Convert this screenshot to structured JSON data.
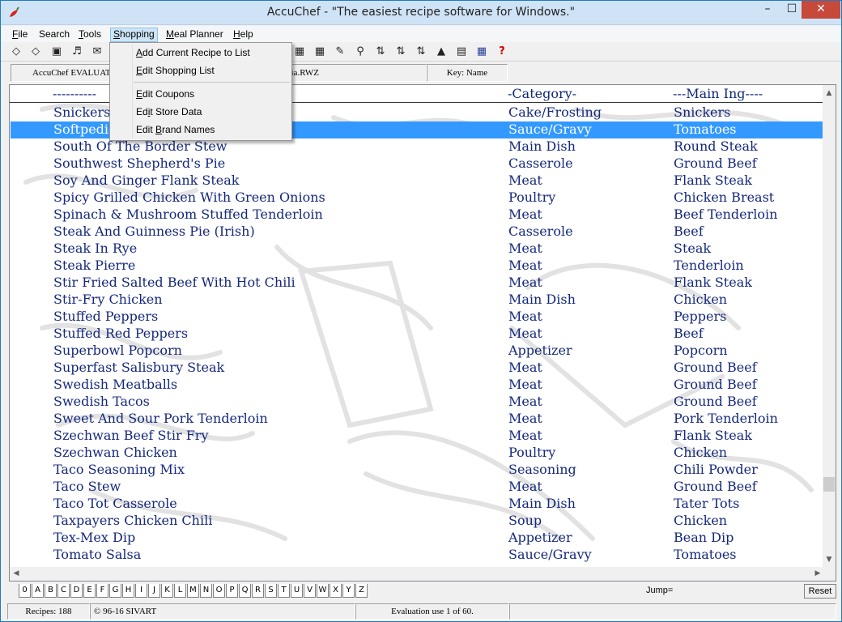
{
  "window": {
    "title": "AccuChef - \"The easiest recipe software for Windows.\""
  },
  "controls": {
    "minimize": "–",
    "maximize": "☐",
    "close": "✕"
  },
  "menu": [
    {
      "label": "File",
      "key": "F",
      "rest": "ile"
    },
    {
      "label": "Search",
      "key": "",
      "rest": "Search"
    },
    {
      "label": "Tools",
      "key": "T",
      "rest": "ools"
    },
    {
      "label": "Shopping",
      "key": "S",
      "rest": "hopping"
    },
    {
      "label": "Meal Planner",
      "key": "M",
      "rest": "eal Planner"
    },
    {
      "label": "Help",
      "key": "H",
      "rest": "elp"
    }
  ],
  "shopping_menu": {
    "items": [
      {
        "pre": "",
        "key": "A",
        "post": "dd Current Recipe to List"
      },
      {
        "pre": "",
        "key": "E",
        "post": "dit Shopping List"
      },
      {
        "pre": "",
        "key": "E",
        "post": "dit Coupons"
      },
      {
        "pre": "Ed",
        "key": "i",
        "post": "t Store Data"
      },
      {
        "pre": "Edit ",
        "key": "B",
        "post": "rand Names"
      }
    ]
  },
  "infobar": {
    "file_left": "AccuChef EVALUAT",
    "file_right": "dia.RWZ",
    "key": "Key: Name"
  },
  "list": {
    "headers": {
      "name": "----------",
      "category": "-Category-",
      "ingredient": "---Main Ing----"
    },
    "rows": [
      {
        "name": "Snickers",
        "category": "Cake/Frosting",
        "ingredient": "Snickers"
      },
      {
        "name": "Softpedia",
        "category": "Sauce/Gravy",
        "ingredient": "Tomatoes"
      },
      {
        "name": "South Of The Border Stew",
        "category": "Main Dish",
        "ingredient": "Round Steak"
      },
      {
        "name": "Southwest Shepherd's Pie",
        "category": "Casserole",
        "ingredient": "Ground Beef"
      },
      {
        "name": "Soy And Ginger Flank Steak",
        "category": "Meat",
        "ingredient": "Flank Steak"
      },
      {
        "name": "Spicy Grilled Chicken With Green Onions",
        "category": "Poultry",
        "ingredient": "Chicken Breast"
      },
      {
        "name": "Spinach & Mushroom Stuffed Tenderloin",
        "category": "Meat",
        "ingredient": "Beef Tenderloin"
      },
      {
        "name": "Steak And Guinness Pie (Irish)",
        "category": "Casserole",
        "ingredient": "Beef"
      },
      {
        "name": "Steak In Rye",
        "category": "Meat",
        "ingredient": "Steak"
      },
      {
        "name": "Steak Pierre",
        "category": "Meat",
        "ingredient": "Tenderloin"
      },
      {
        "name": "Stir Fried Salted Beef With Hot Chili",
        "category": "Meat",
        "ingredient": "Flank Steak"
      },
      {
        "name": "Stir-Fry Chicken",
        "category": "Main Dish",
        "ingredient": "Chicken"
      },
      {
        "name": "Stuffed Peppers",
        "category": "Meat",
        "ingredient": "Peppers"
      },
      {
        "name": "Stuffed Red Peppers",
        "category": "Meat",
        "ingredient": "Beef"
      },
      {
        "name": "Superbowl Popcorn",
        "category": "Appetizer",
        "ingredient": "Popcorn"
      },
      {
        "name": "Superfast Salisbury Steak",
        "category": "Meat",
        "ingredient": "Ground Beef"
      },
      {
        "name": "Swedish Meatballs",
        "category": "Meat",
        "ingredient": "Ground Beef"
      },
      {
        "name": "Swedish Tacos",
        "category": "Meat",
        "ingredient": "Ground Beef"
      },
      {
        "name": "Sweet And Sour Pork Tenderloin",
        "category": "Meat",
        "ingredient": "Pork Tenderloin"
      },
      {
        "name": "Szechwan Beef Stir Fry",
        "category": "Meat",
        "ingredient": "Flank Steak"
      },
      {
        "name": "Szechwan Chicken",
        "category": "Poultry",
        "ingredient": "Chicken"
      },
      {
        "name": "Taco Seasoning Mix",
        "category": "Seasoning",
        "ingredient": "Chili Powder"
      },
      {
        "name": "Taco Stew",
        "category": "Meat",
        "ingredient": "Ground Beef"
      },
      {
        "name": "Taco Tot Casserole",
        "category": "Main Dish",
        "ingredient": "Tater Tots"
      },
      {
        "name": "Taxpayers Chicken Chili",
        "category": "Soup",
        "ingredient": "Chicken"
      },
      {
        "name": "Tex-Mex Dip",
        "category": "Appetizer",
        "ingredient": "Bean Dip"
      },
      {
        "name": "Tomato Salsa",
        "category": "Sauce/Gravy",
        "ingredient": "Tomatoes"
      }
    ],
    "selected_index": 1
  },
  "alphabet": [
    "0",
    "A",
    "B",
    "C",
    "D",
    "E",
    "F",
    "G",
    "H",
    "I",
    "J",
    "K",
    "L",
    "M",
    "N",
    "O",
    "P",
    "Q",
    "R",
    "S",
    "T",
    "U",
    "V",
    "W",
    "X",
    "Y",
    "Z"
  ],
  "jump_label": "Jump=",
  "reset_label": "Reset",
  "status": {
    "recipes": "Recipes: 188",
    "copyright": "© 96-16 SIVART",
    "evaluation": "Evaluation use 1 of 60."
  },
  "icons": {
    "scroll_up": "▲",
    "scroll_down": "▼",
    "scroll_left": "◀",
    "scroll_right": "▶"
  },
  "colors": {
    "selection": "#3399ff",
    "list_text": "#14287c",
    "title_bar": "#cfe3f7",
    "close_button": "#c7493a"
  }
}
